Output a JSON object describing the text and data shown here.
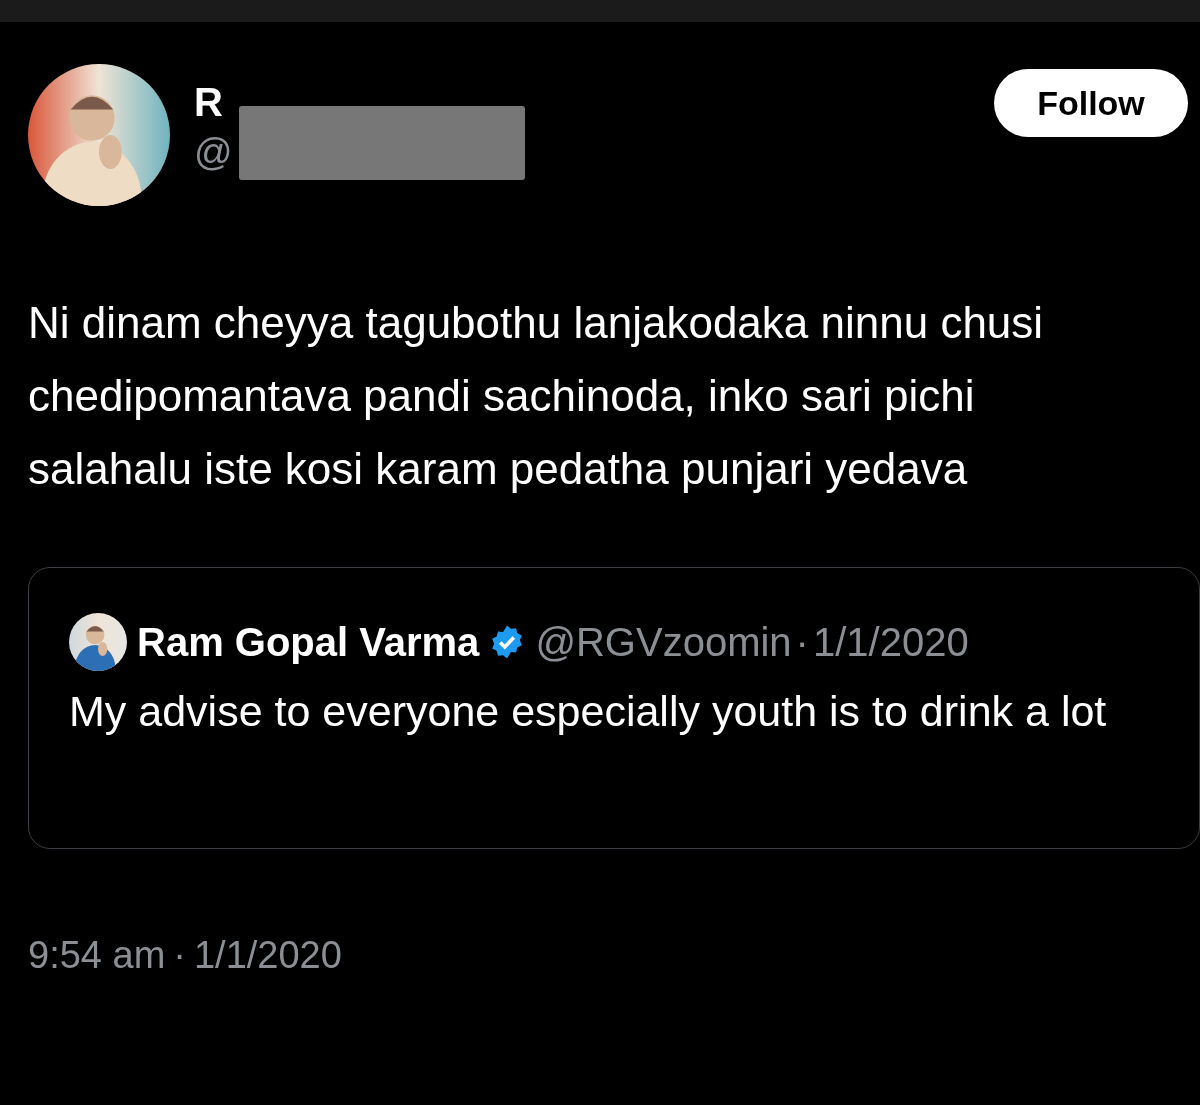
{
  "author": {
    "name": "R",
    "handle": "@",
    "redacted": true
  },
  "follow_button": {
    "label": "Follow"
  },
  "post_text": "Ni dinam cheyya tagubothu lanjakodaka ninnu chusi chedipomantava pandi sachinoda, inko sari pichi salahalu iste kosi karam pedatha punjari yedava",
  "quoted_post": {
    "name": "Ram Gopal Varma",
    "verified": true,
    "handle": "@RGVzoomin",
    "separator": "·",
    "date": "1/1/2020",
    "text": "My advise to everyone especially youth is to drink a lot"
  },
  "timestamp": {
    "time": "9:54 am",
    "separator": "·",
    "date": "1/1/2020"
  }
}
